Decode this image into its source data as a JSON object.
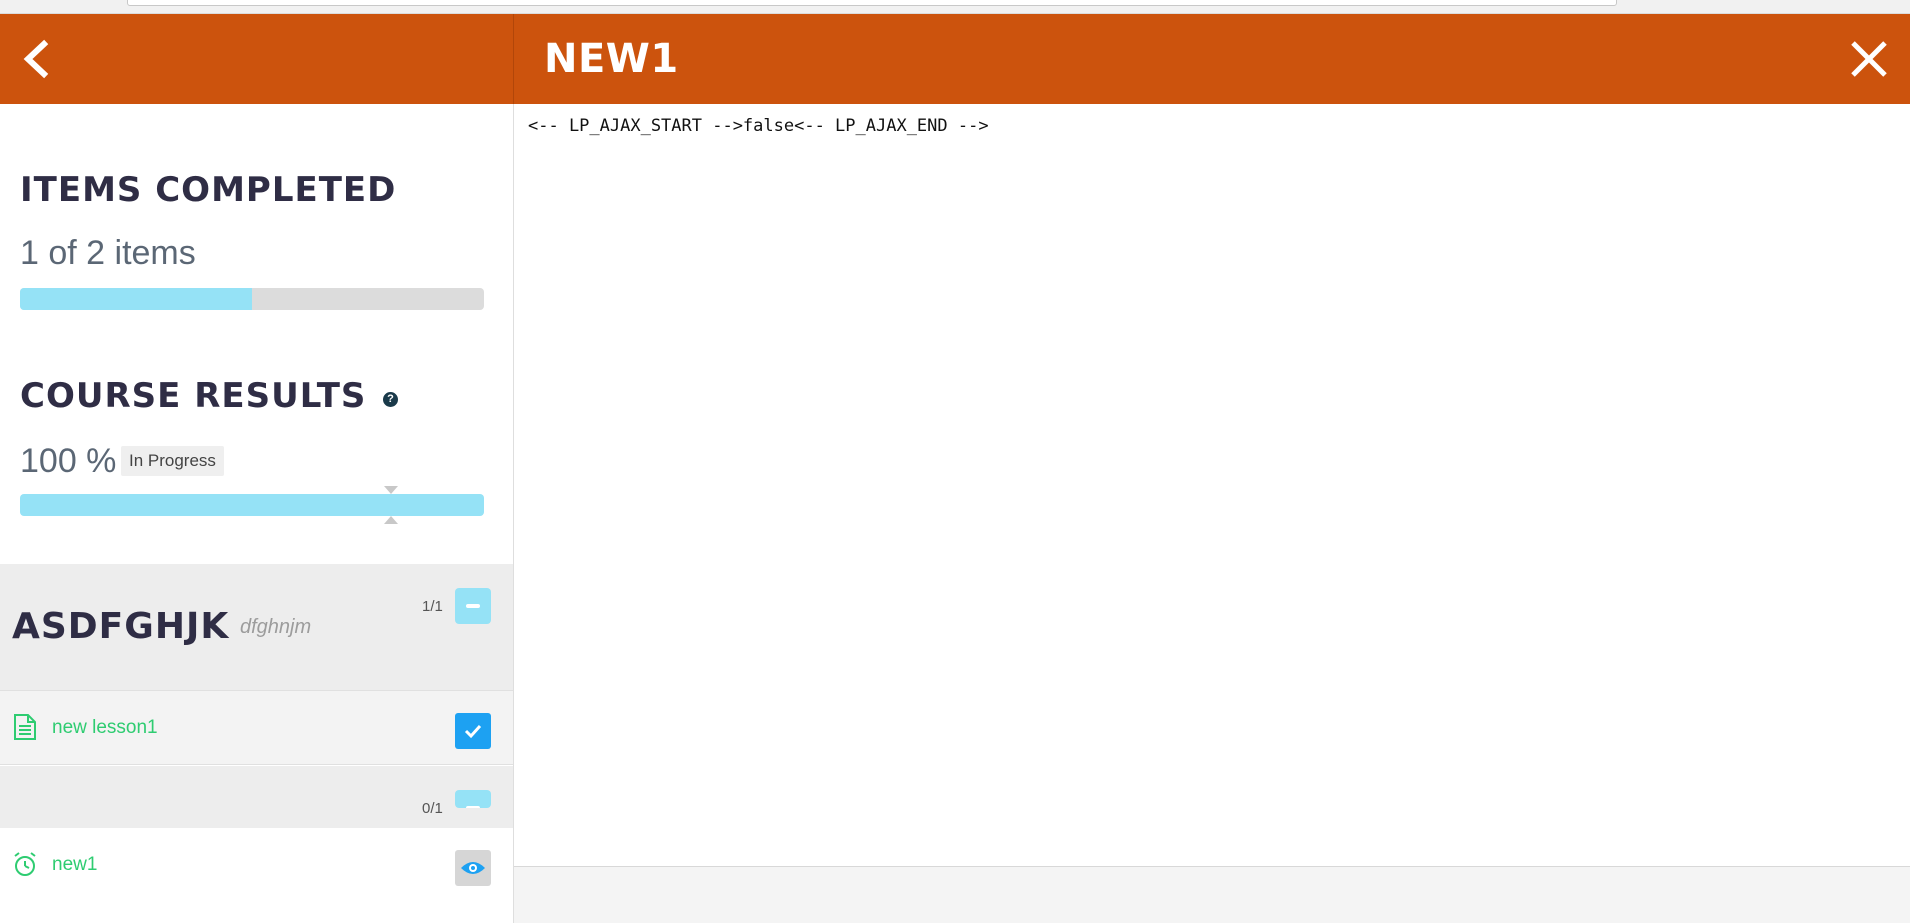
{
  "header": {
    "title": "NEW1",
    "back_icon": "chevron-left-icon",
    "close_icon": "close-icon",
    "color": "#cc530d"
  },
  "sidebar": {
    "items_completed": {
      "heading": "ITEMS COMPLETED",
      "count_text": "1 of 2 items",
      "progress_fraction": 0.5
    },
    "course_results": {
      "heading": "COURSE RESULTS",
      "help_icon": "question-icon",
      "help_glyph": "?",
      "percent_text": "100 %",
      "status_badge": "In Progress",
      "progress_fraction": 1.0,
      "passing_marker_fraction": 0.8
    },
    "sections": [
      {
        "title": "ASDFGHJK",
        "description": "dfghnjm",
        "count": "1/1",
        "items": [
          {
            "label": "new lesson1",
            "icon": "document-icon",
            "status": "completed"
          }
        ]
      },
      {
        "title": "",
        "description": "",
        "count": "0/1",
        "items": [
          {
            "label": "new1",
            "icon": "alarm-clock-icon",
            "status": "viewing"
          }
        ]
      }
    ]
  },
  "content": {
    "raw_text": "<-- LP_AJAX_START -->false<-- LP_AJAX_END -->"
  },
  "colors": {
    "accent": "#cc530d",
    "progress": "#95e2f6",
    "lesson_text": "#2ecc71",
    "check": "#1da1f2"
  }
}
